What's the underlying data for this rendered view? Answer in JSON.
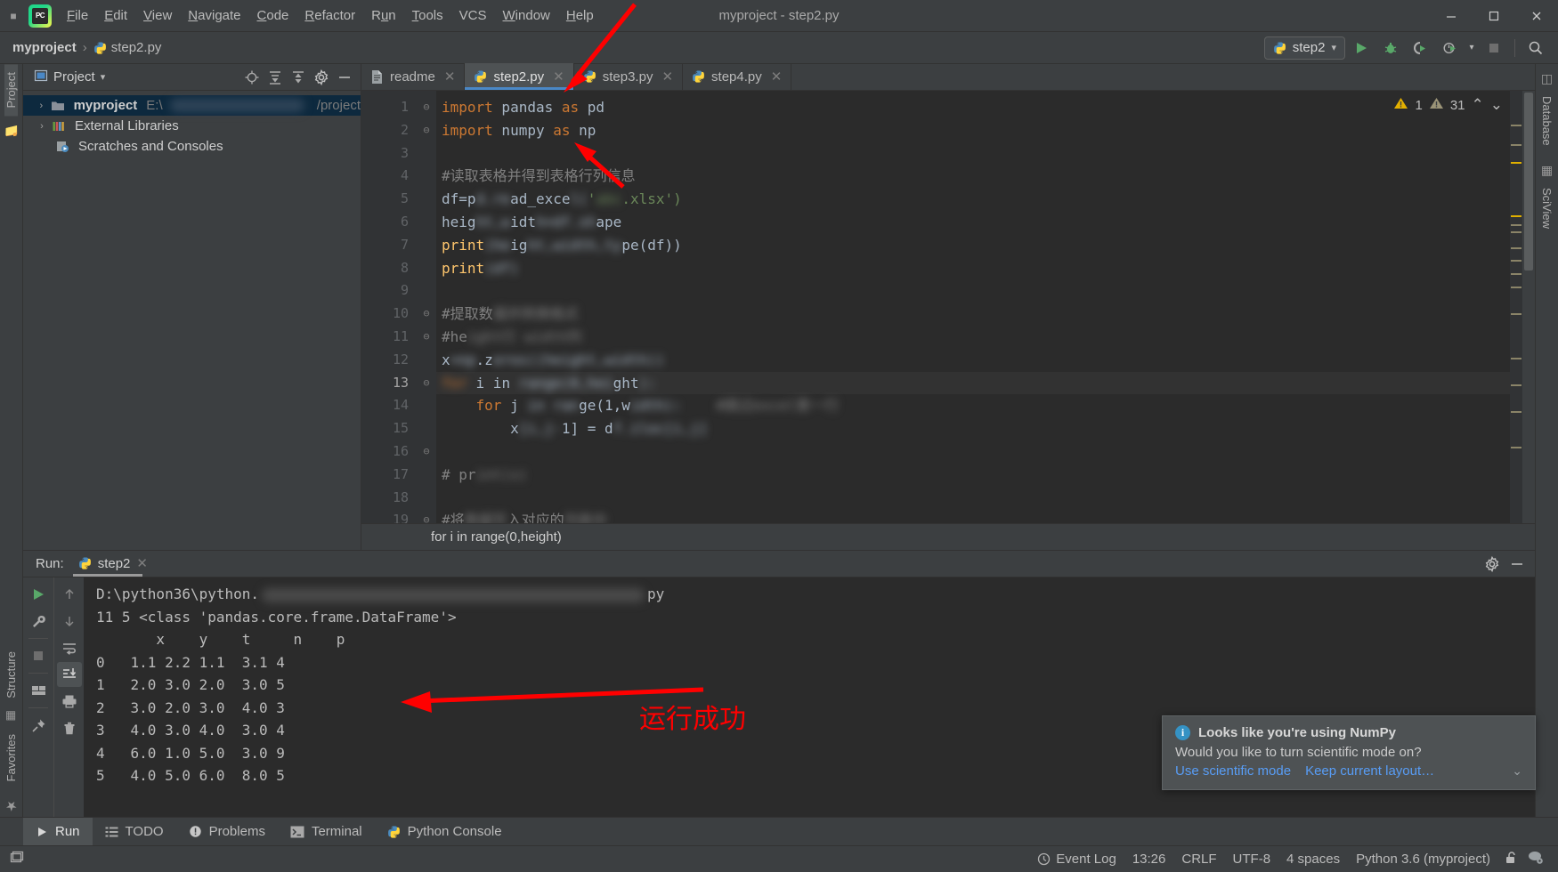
{
  "window": {
    "title": "myproject - step2.py",
    "minimize_label": "—",
    "maximize_label": "☐",
    "close_label": "✕"
  },
  "menu": {
    "items": [
      {
        "label": "File",
        "mnemonic": "F"
      },
      {
        "label": "Edit",
        "mnemonic": "E"
      },
      {
        "label": "View",
        "mnemonic": "V"
      },
      {
        "label": "Navigate",
        "mnemonic": "N"
      },
      {
        "label": "Code",
        "mnemonic": "C"
      },
      {
        "label": "Refactor",
        "mnemonic": "R"
      },
      {
        "label": "Run",
        "mnemonic": "u"
      },
      {
        "label": "Tools",
        "mnemonic": "T"
      },
      {
        "label": "VCS",
        "mnemonic": ""
      },
      {
        "label": "Window",
        "mnemonic": "W"
      },
      {
        "label": "Help",
        "mnemonic": "H"
      }
    ]
  },
  "navbar": {
    "breadcrumb_project": "myproject",
    "breadcrumb_sep": "›",
    "breadcrumb_file": "step2.py",
    "run_config": "step2",
    "run_config_caret": "▾",
    "buttons": [
      {
        "name": "run-button",
        "icon": "play-icon"
      },
      {
        "name": "debug-button",
        "icon": "bug-icon"
      },
      {
        "name": "run-coverage-button",
        "icon": "coverage-icon"
      },
      {
        "name": "profile-button",
        "icon": "profile-icon"
      },
      {
        "name": "stop-button",
        "icon": "stop-icon"
      },
      {
        "name": "search-everywhere-button",
        "icon": "search-icon"
      }
    ]
  },
  "left_stripe": {
    "project_tab": "Project",
    "structure_tab": "Structure",
    "favorites_tab": "Favorites"
  },
  "right_stripe": {
    "database_tab": "Database",
    "sciview_tab": "SciView"
  },
  "project_panel": {
    "title": "Project",
    "title_caret": "▾",
    "header_icons": [
      "locate-icon",
      "expand-all-icon",
      "collapse-all-icon",
      "settings-icon",
      "hide-icon"
    ],
    "tree": [
      {
        "label": "myproject",
        "path_prefix": "E:\\",
        "path_suffix": "/project",
        "bold": true,
        "icon": "folder-icon",
        "arrow": "›",
        "selected": true,
        "redacted": true
      },
      {
        "label": "External Libraries",
        "bold": false,
        "icon": "libraries-icon",
        "arrow": "›",
        "selected": false
      },
      {
        "label": "Scratches and Consoles",
        "bold": false,
        "icon": "scratches-icon",
        "arrow": "",
        "selected": false
      }
    ]
  },
  "editor": {
    "tabs": [
      {
        "label": "readme",
        "icon": "text-file-icon",
        "active": false,
        "close": "✕"
      },
      {
        "label": "step2.py",
        "icon": "python-file-icon",
        "active": true,
        "close": "✕"
      },
      {
        "label": "step3.py",
        "icon": "python-file-icon",
        "active": false,
        "close": "✕"
      },
      {
        "label": "step4.py",
        "icon": "python-file-icon",
        "active": false,
        "close": "✕"
      }
    ],
    "inspections": {
      "warning_count": "1",
      "weak_warning_count": "31",
      "up_arrow": "⌃",
      "down_arrow": "⌄"
    },
    "breadcrumb_statement": "for i in range(0,height)",
    "current_line": 13,
    "lines": [
      {
        "n": 1,
        "fold": "⊖",
        "segments": [
          {
            "t": "import",
            "c": "kw"
          },
          {
            "t": " pandas ",
            "c": ""
          },
          {
            "t": "as",
            "c": "kw"
          },
          {
            "t": " pd",
            "c": ""
          }
        ]
      },
      {
        "n": 2,
        "fold": "⊖",
        "segments": [
          {
            "t": "import",
            "c": "kw"
          },
          {
            "t": " numpy ",
            "c": ""
          },
          {
            "t": "as",
            "c": "kw"
          },
          {
            "t": " np",
            "c": ""
          }
        ]
      },
      {
        "n": 3,
        "fold": "",
        "segments": []
      },
      {
        "n": 4,
        "fold": "",
        "segments": [
          {
            "t": "#读取表格并得到表格行列信息",
            "c": "cmt"
          }
        ]
      },
      {
        "n": 5,
        "fold": "",
        "segments": [
          {
            "t": "df=p",
            "c": ""
          },
          {
            "t": "d.re",
            "c": "blur"
          },
          {
            "t": "ad_exce",
            "c": ""
          },
          {
            "t": "l(",
            "c": "blur"
          },
          {
            "t": "'",
            "c": "str"
          },
          {
            "t": "abc",
            "c": "blurstr"
          },
          {
            "t": ".xlsx')",
            "c": "str"
          }
        ]
      },
      {
        "n": 6,
        "fold": "",
        "segments": [
          {
            "t": "heig",
            "c": ""
          },
          {
            "t": "ht,w",
            "c": "blur"
          },
          {
            "t": "idt",
            "c": ""
          },
          {
            "t": "h=df.sh",
            "c": "blur"
          },
          {
            "t": "ape",
            "c": ""
          }
        ]
      },
      {
        "n": 7,
        "fold": "",
        "segments": [
          {
            "t": "print",
            "c": "fn"
          },
          {
            "t": "(he",
            "c": "blur"
          },
          {
            "t": "ig",
            "c": ""
          },
          {
            "t": "ht,width,ty",
            "c": "blur"
          },
          {
            "t": "pe(df))",
            "c": ""
          }
        ]
      },
      {
        "n": 8,
        "fold": "",
        "segments": [
          {
            "t": "print",
            "c": "fn"
          },
          {
            "t": "(df)",
            "c": "blur"
          }
        ]
      },
      {
        "n": 9,
        "fold": "",
        "segments": []
      },
      {
        "n": 10,
        "fold": "⊖",
        "segments": [
          {
            "t": "#提取数",
            "c": "cmt"
          },
          {
            "t": "据并转换格式",
            "c": "blurcmt"
          }
        ]
      },
      {
        "n": 11,
        "fold": "⊖",
        "segments": [
          {
            "t": "#he",
            "c": "cmt"
          },
          {
            "t": "ight行 width列",
            "c": "blurcmt"
          }
        ]
      },
      {
        "n": 12,
        "fold": "",
        "segments": [
          {
            "t": "x",
            "c": ""
          },
          {
            "t": "=np",
            "c": "blur"
          },
          {
            "t": ".z",
            "c": ""
          },
          {
            "t": "eros((height,width))",
            "c": "blur"
          }
        ]
      },
      {
        "n": 13,
        "fold": "⊖",
        "segments": [
          {
            "t": "for",
            "c": "blurkw"
          },
          {
            "t": " i in ",
            "c": ""
          },
          {
            "t": "range(0,hei",
            "c": "blur"
          },
          {
            "t": "ght",
            "c": ""
          },
          {
            "t": "):",
            "c": "blur"
          }
        ]
      },
      {
        "n": 14,
        "fold": "",
        "segments": [
          {
            "t": "    ",
            "c": ""
          },
          {
            "t": "for",
            "c": "kw"
          },
          {
            "t": " j ",
            "c": ""
          },
          {
            "t": "in ran",
            "c": "blur"
          },
          {
            "t": "ge(1,w",
            "c": ""
          },
          {
            "t": "idth):",
            "c": "blur"
          },
          {
            "t": "    #跳过excel第一行",
            "c": "blurcmt"
          }
        ]
      },
      {
        "n": 15,
        "fold": "",
        "segments": [
          {
            "t": "        ",
            "c": ""
          },
          {
            "t": "x",
            "c": ""
          },
          {
            "t": "[i,j-",
            "c": "blur"
          },
          {
            "t": "1] = d",
            "c": ""
          },
          {
            "t": "f.iloc[i,j]",
            "c": "blur"
          }
        ]
      },
      {
        "n": 16,
        "fold": "⊖",
        "segments": []
      },
      {
        "n": 17,
        "fold": "",
        "segments": [
          {
            "t": "# pr",
            "c": "cmt"
          },
          {
            "t": "int(x)",
            "c": "blurcmt"
          }
        ]
      },
      {
        "n": 18,
        "fold": "",
        "segments": []
      },
      {
        "n": 19,
        "fold": "⊖",
        "segments": [
          {
            "t": "#将",
            "c": "cmt"
          },
          {
            "t": "数据写",
            "c": "blurcmt"
          },
          {
            "t": "入对应的",
            "c": "cmt"
          },
          {
            "t": "列表中",
            "c": "blurcmt"
          }
        ]
      }
    ]
  },
  "run_panel": {
    "label": "Run:",
    "tab_name": "step2",
    "tab_close": "✕",
    "header_icons": [
      "settings-icon",
      "hide-icon"
    ],
    "left_tools": [
      "rerun-icon",
      "wrench-icon",
      "stop-icon",
      "layout-icon",
      "pin-icon"
    ],
    "right_tools": [
      "up-arrow-icon",
      "down-arrow-icon",
      "soft-wrap-icon",
      "scroll-to-end-icon",
      "print-icon",
      "trash-icon"
    ],
    "console": {
      "command_line_prefix": "D:\\python36\\python.",
      "command_line_suffix": "py",
      "shape_line": "11 5 <class 'pandas.core.frame.DataFrame'>",
      "table_header": [
        "x",
        "y",
        "t",
        "n",
        "p"
      ],
      "table_rows": [
        {
          "index": "0",
          "x": "1.1",
          "y": "2.2",
          "t": "1.1",
          "n": "3.1",
          "p": "4"
        },
        {
          "index": "1",
          "x": "2.0",
          "y": "3.0",
          "t": "2.0",
          "n": "3.0",
          "p": "5"
        },
        {
          "index": "2",
          "x": "3.0",
          "y": "2.0",
          "t": "3.0",
          "n": "4.0",
          "p": "3"
        },
        {
          "index": "3",
          "x": "4.0",
          "y": "3.0",
          "t": "4.0",
          "n": "3.0",
          "p": "4"
        },
        {
          "index": "4",
          "x": "6.0",
          "y": "1.0",
          "t": "5.0",
          "n": "3.0",
          "p": "9"
        },
        {
          "index": "5",
          "x": "4.0",
          "y": "5.0",
          "t": "6.0",
          "n": "8.0",
          "p": "5"
        }
      ]
    }
  },
  "notification": {
    "icon": "info-icon",
    "title": "Looks like you're using NumPy",
    "message": "Would you like to turn scientific mode on?",
    "action_primary": "Use scientific mode",
    "action_secondary": "Keep current layout…",
    "expand_caret": "⌄"
  },
  "bottom_toolbar": {
    "items": [
      {
        "label": "Run",
        "icon": "play-icon",
        "active": true
      },
      {
        "label": "TODO",
        "icon": "todo-icon",
        "active": false
      },
      {
        "label": "Problems",
        "icon": "problems-icon",
        "active": false
      },
      {
        "label": "Terminal",
        "icon": "terminal-icon",
        "active": false
      },
      {
        "label": "Python Console",
        "icon": "python-icon",
        "active": false
      }
    ]
  },
  "status_bar": {
    "event_log": "Event Log",
    "time": "13:26",
    "line_separator": "CRLF",
    "encoding": "UTF-8",
    "indent": "4 spaces",
    "interpreter": "Python 3.6 (myproject)",
    "lock_icon": "unlocked-icon",
    "inspection_icon": "inspection-level-icon"
  },
  "annotations": {
    "success_text": "运行成功",
    "color": "#ff0000"
  },
  "colors": {
    "accent_blue": "#4a88c7",
    "link_blue": "#589df6",
    "warning_yellow": "#e0b000",
    "run_green": "#499c54",
    "background": "#3c3f41",
    "editor_background": "#2b2b2b",
    "annotation_red": "#ff0000"
  }
}
